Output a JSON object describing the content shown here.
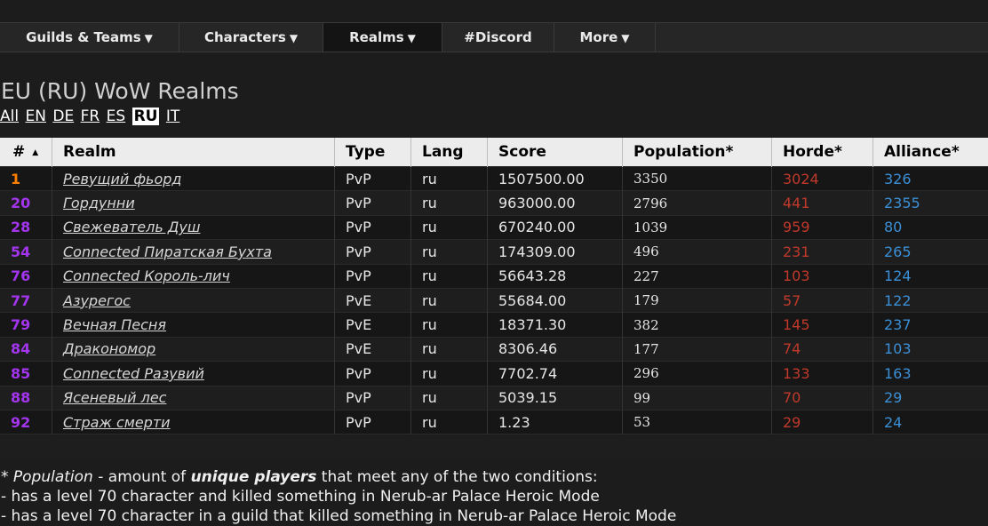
{
  "nav": {
    "items": [
      {
        "label": "Guilds & Teams",
        "caret": "▼"
      },
      {
        "label": "Characters",
        "caret": "▼"
      },
      {
        "label": "Realms",
        "caret": "▼"
      },
      {
        "label": "#Discord",
        "caret": ""
      },
      {
        "label": "More",
        "caret": "▼"
      }
    ]
  },
  "page": {
    "title": "EU (RU) WoW Realms",
    "filters": [
      "All",
      "EN",
      "DE",
      "FR",
      "ES",
      "RU",
      "IT"
    ],
    "active_filter": "RU"
  },
  "table": {
    "headers": [
      "#",
      "Realm",
      "Type",
      "Lang",
      "Score",
      "Population*",
      "Horde*",
      "Alliance*"
    ],
    "sort_indicator": "▲",
    "rows": [
      {
        "rank": "1",
        "realm": "Ревущий фьорд",
        "type": "PvP",
        "lang": "ru",
        "score": "1507500.00",
        "population": "3350",
        "horde": "3024",
        "alliance": "326"
      },
      {
        "rank": "20",
        "realm": "Гордунни",
        "type": "PvP",
        "lang": "ru",
        "score": "963000.00",
        "population": "2796",
        "horde": "441",
        "alliance": "2355"
      },
      {
        "rank": "28",
        "realm": "Свежеватель Душ",
        "type": "PvP",
        "lang": "ru",
        "score": "670240.00",
        "population": "1039",
        "horde": "959",
        "alliance": "80"
      },
      {
        "rank": "54",
        "realm": "Connected Пиратская Бухта",
        "type": "PvP",
        "lang": "ru",
        "score": "174309.00",
        "population": "496",
        "horde": "231",
        "alliance": "265"
      },
      {
        "rank": "76",
        "realm": "Connected Король-лич",
        "type": "PvP",
        "lang": "ru",
        "score": "56643.28",
        "population": "227",
        "horde": "103",
        "alliance": "124"
      },
      {
        "rank": "77",
        "realm": "Азурегос",
        "type": "PvE",
        "lang": "ru",
        "score": "55684.00",
        "population": "179",
        "horde": "57",
        "alliance": "122"
      },
      {
        "rank": "79",
        "realm": "Вечная Песня",
        "type": "PvE",
        "lang": "ru",
        "score": "18371.30",
        "population": "382",
        "horde": "145",
        "alliance": "237"
      },
      {
        "rank": "84",
        "realm": "Дракономор",
        "type": "PvE",
        "lang": "ru",
        "score": "8306.46",
        "population": "177",
        "horde": "74",
        "alliance": "103"
      },
      {
        "rank": "85",
        "realm": "Connected Разувий",
        "type": "PvP",
        "lang": "ru",
        "score": "7702.74",
        "population": "296",
        "horde": "133",
        "alliance": "163"
      },
      {
        "rank": "88",
        "realm": "Ясеневый лес",
        "type": "PvP",
        "lang": "ru",
        "score": "5039.15",
        "population": "99",
        "horde": "70",
        "alliance": "29"
      },
      {
        "rank": "92",
        "realm": "Страж смерти",
        "type": "PvP",
        "lang": "ru",
        "score": "1.23",
        "population": "53",
        "horde": "29",
        "alliance": "24"
      }
    ]
  },
  "footnote": {
    "star": "* ",
    "term": "Population",
    "dash": " - amount of ",
    "emph": "unique players",
    "tail": " that meet any of the two conditions:",
    "line1": "- has a level 70 character and killed something in Nerub-ar Palace Heroic Mode",
    "line2": "- has a level 70 character in a guild that killed something in Nerub-ar Palace Heroic Mode"
  },
  "colors": {
    "rank_top": "#ff8000",
    "rank_rest": "#a335ee",
    "horde": "#c0392b",
    "alliance": "#3b8fd6"
  }
}
